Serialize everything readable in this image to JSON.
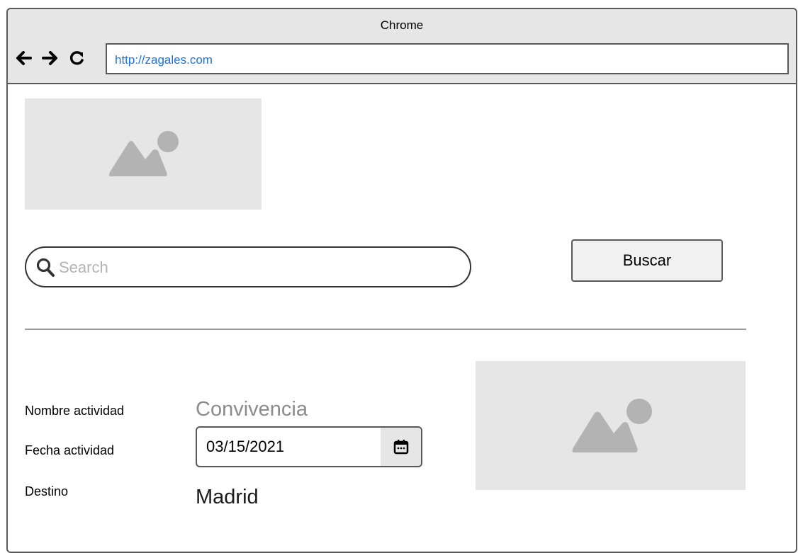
{
  "browser": {
    "title": "Chrome",
    "url": "http://zagales.com",
    "icons": [
      "back-arrow-icon",
      "forward-arrow-icon",
      "reload-icon"
    ]
  },
  "search": {
    "placeholder": "Search",
    "button_label": "Buscar"
  },
  "activity": {
    "name_label": "Nombre actividad",
    "name_value": "Convivencia",
    "date_label": "Fecha actividad",
    "date_value": "03/15/2021",
    "destination_label": "Destino",
    "destination_value": "Madrid"
  },
  "colors": {
    "chrome_bg": "#e6e6e6",
    "border": "#595959",
    "url_text": "#1a73e8",
    "placeholder_bg": "#e6e6e6",
    "placeholder_shape": "#b3b3b3",
    "muted_value": "#8c8c8c"
  }
}
